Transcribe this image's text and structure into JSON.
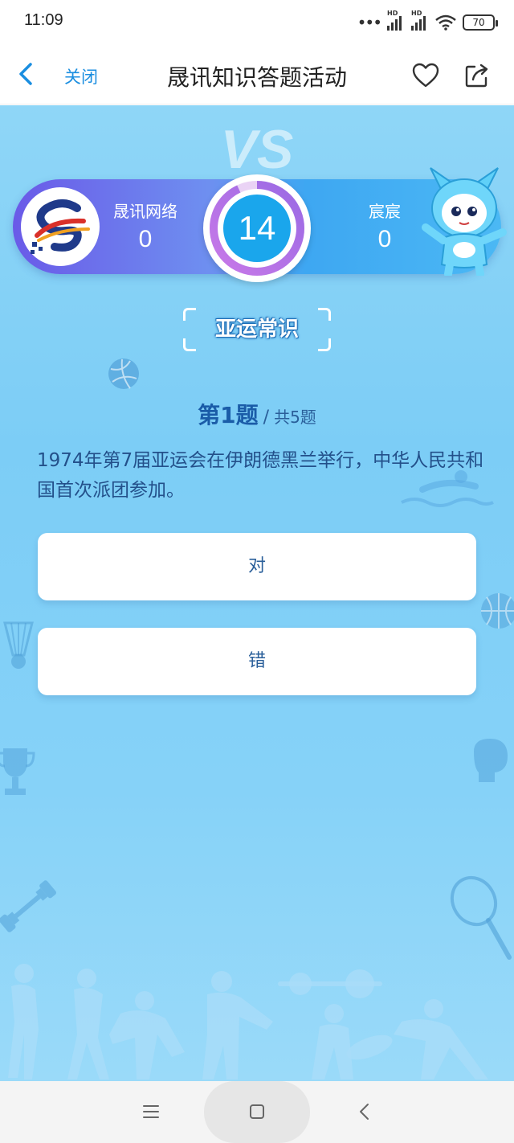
{
  "status_bar": {
    "time": "11:09",
    "battery": "70",
    "signal_label": "HD"
  },
  "nav": {
    "close_label": "关闭",
    "title": "晟讯知识答题活动",
    "back_icon": "chevron-left-icon",
    "favorite_icon": "heart-icon",
    "share_icon": "share-icon",
    "accent": "#1a8ee0"
  },
  "match": {
    "vs_label": "VS",
    "player1": {
      "name": "晟讯网络",
      "score": "0"
    },
    "player2": {
      "name": "宸宸",
      "score": "0"
    },
    "timer": {
      "seconds": "14",
      "progress": 0.93
    }
  },
  "category": "亚运常识",
  "question": {
    "number_label": "第1题",
    "slash": "/",
    "total_label": "共5题",
    "text": "1974年第7届亚运会在伊朗德黑兰举行，中华人民共和国首次派团参加。"
  },
  "answers": {
    "true_label": "对",
    "false_label": "错"
  },
  "system_nav": {
    "menu_icon": "menu-icon",
    "home_icon": "home-icon",
    "back_icon": "back-icon"
  }
}
